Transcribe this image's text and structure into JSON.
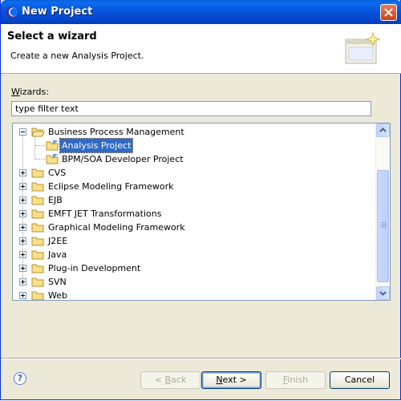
{
  "window": {
    "title": "New Project"
  },
  "banner": {
    "title": "Select a wizard",
    "description": "Create a new Analysis Project."
  },
  "wizards": {
    "label_underlined": "W",
    "label_rest": "izards:",
    "filter_placeholder": "type filter text"
  },
  "tree": {
    "items": [
      {
        "label": "Business Process Management",
        "expanded": true,
        "level": 0
      },
      {
        "label": "Analysis Project",
        "level": 1,
        "selected": true
      },
      {
        "label": "BPM/SOA Developer Project",
        "level": 1
      },
      {
        "label": "CVS",
        "level": 0,
        "expanded": false
      },
      {
        "label": "Eclipse Modeling Framework",
        "level": 0,
        "expanded": false
      },
      {
        "label": "EJB",
        "level": 0,
        "expanded": false
      },
      {
        "label": "EMFT JET Transformations",
        "level": 0,
        "expanded": false
      },
      {
        "label": "Graphical Modeling Framework",
        "level": 0,
        "expanded": false
      },
      {
        "label": "J2EE",
        "level": 0,
        "expanded": false
      },
      {
        "label": "Java",
        "level": 0,
        "expanded": false
      },
      {
        "label": "Plug-in Development",
        "level": 0,
        "expanded": false
      },
      {
        "label": "SVN",
        "level": 0,
        "expanded": false
      },
      {
        "label": "Web",
        "level": 0,
        "expanded": false
      }
    ]
  },
  "buttons": {
    "back_pre": "< ",
    "back_u": "B",
    "back_post": "ack",
    "next_u": "N",
    "next_post": "ext >",
    "finish_u": "F",
    "finish_post": "inish",
    "cancel": "Cancel",
    "help": "?"
  },
  "colors": {
    "selection": "#316ac5",
    "titlebar": "#0855dd"
  }
}
